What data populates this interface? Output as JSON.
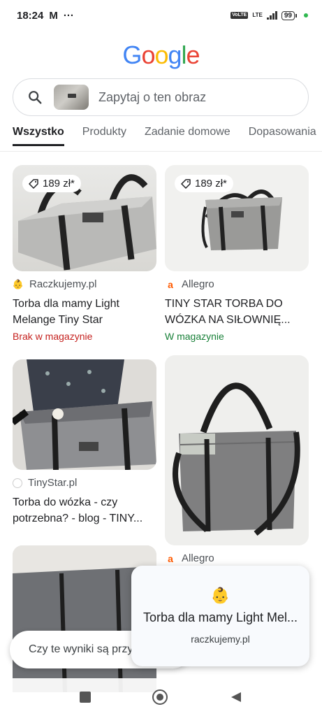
{
  "status": {
    "time": "18:24",
    "mail_icon": "M",
    "more": "···",
    "mini_badge": "VoLTE",
    "lte": "LTE",
    "battery": "99"
  },
  "logo": {
    "letters": [
      "G",
      "o",
      "o",
      "g",
      "l",
      "e"
    ],
    "colors": [
      "#4285F4",
      "#EA4335",
      "#FBBC05",
      "#4285F4",
      "#34A853",
      "#EA4335"
    ]
  },
  "search": {
    "placeholder": "Zapytaj o ten obraz"
  },
  "tabs": [
    {
      "label": "Wszystko",
      "active": true
    },
    {
      "label": "Produkty"
    },
    {
      "label": "Zadanie domowe"
    },
    {
      "label": "Dopasowania"
    }
  ],
  "results": [
    {
      "price": "189 zł*",
      "source": "Raczkujemy.pl",
      "title": "Torba dla mamy Light Melange Tiny Star",
      "stock": "Brak w magazynie"
    },
    {
      "price": "189 zł*",
      "source": "Allegro",
      "title": "TINY STAR TORBA DO WÓZKA NA SIŁOWNIĘ...",
      "stock": "W magazynie"
    },
    {
      "source": "TinyStar.pl",
      "title": "Torba do wózka - czy potrzebna? - blog - TINY..."
    },
    {
      "source": "Allegro"
    }
  ],
  "feedback": {
    "text": "Czy te wyniki są przydatne?"
  },
  "popup": {
    "title": "Torba dla mamy Light Mel...",
    "domain": "raczkujemy.pl"
  }
}
